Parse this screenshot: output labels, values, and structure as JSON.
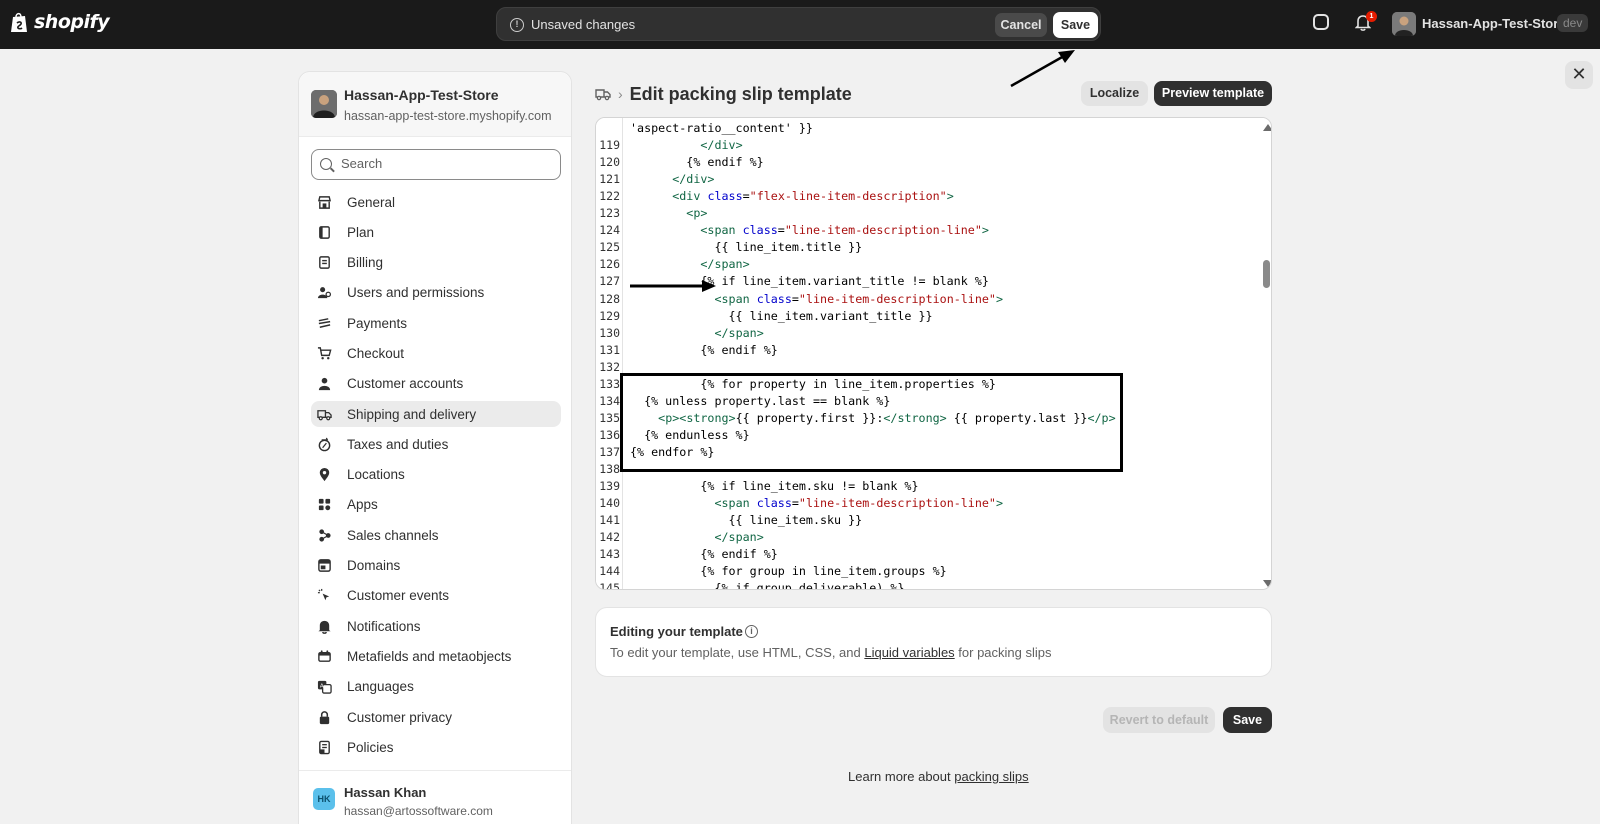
{
  "topbar": {
    "logo_text": "shopify",
    "unsaved_message": "Unsaved changes",
    "cancel_label": "Cancel",
    "save_label": "Save",
    "notification_count": "1",
    "store_name": "Hassan-App-Test-Store",
    "env_badge": "dev"
  },
  "sidebar": {
    "store_name": "Hassan-App-Test-Store",
    "store_url": "hassan-app-test-store.myshopify.com",
    "search_placeholder": "Search",
    "items": [
      {
        "label": "General",
        "icon": "store-icon"
      },
      {
        "label": "Plan",
        "icon": "plan-icon"
      },
      {
        "label": "Billing",
        "icon": "billing-icon"
      },
      {
        "label": "Users and permissions",
        "icon": "users-icon"
      },
      {
        "label": "Payments",
        "icon": "payments-icon"
      },
      {
        "label": "Checkout",
        "icon": "cart-icon"
      },
      {
        "label": "Customer accounts",
        "icon": "person-icon"
      },
      {
        "label": "Shipping and delivery",
        "icon": "truck-icon",
        "active": true
      },
      {
        "label": "Taxes and duties",
        "icon": "tax-icon"
      },
      {
        "label": "Locations",
        "icon": "location-icon"
      },
      {
        "label": "Apps",
        "icon": "apps-icon"
      },
      {
        "label": "Sales channels",
        "icon": "sales-channels-icon"
      },
      {
        "label": "Domains",
        "icon": "domains-icon"
      },
      {
        "label": "Customer events",
        "icon": "cursor-icon"
      },
      {
        "label": "Notifications",
        "icon": "bell-icon"
      },
      {
        "label": "Metafields and metaobjects",
        "icon": "metafields-icon"
      },
      {
        "label": "Languages",
        "icon": "languages-icon"
      },
      {
        "label": "Customer privacy",
        "icon": "lock-icon"
      },
      {
        "label": "Policies",
        "icon": "policies-icon"
      }
    ],
    "user": {
      "initials": "HK",
      "name": "Hassan Khan",
      "email": "hassan@artossoftware.com"
    }
  },
  "main": {
    "page_title": "Edit packing slip template",
    "localize_label": "Localize",
    "preview_label": "Preview template",
    "code_lines": [
      {
        "n": "",
        "text": "'aspect-ratio__content' }}"
      },
      {
        "n": "119",
        "text": "          </div>"
      },
      {
        "n": "120",
        "text": "        {% endif %}"
      },
      {
        "n": "121",
        "text": "      </div>"
      },
      {
        "n": "122",
        "text": "      <div class=\"flex-line-item-description\">"
      },
      {
        "n": "123",
        "text": "        <p>"
      },
      {
        "n": "124",
        "text": "          <span class=\"line-item-description-line\">"
      },
      {
        "n": "125",
        "text": "            {{ line_item.title }}"
      },
      {
        "n": "126",
        "text": "          </span>"
      },
      {
        "n": "127",
        "text": "          {% if line_item.variant_title != blank %}"
      },
      {
        "n": "128",
        "text": "            <span class=\"line-item-description-line\">"
      },
      {
        "n": "129",
        "text": "              {{ line_item.variant_title }}"
      },
      {
        "n": "130",
        "text": "            </span>"
      },
      {
        "n": "131",
        "text": "          {% endif %}"
      },
      {
        "n": "132",
        "text": ""
      },
      {
        "n": "133",
        "text": "          {% for property in line_item.properties %}"
      },
      {
        "n": "134",
        "text": "  {% unless property.last == blank %}"
      },
      {
        "n": "135",
        "text": "    <p><strong>{{ property.first }}:</strong> {{ property.last }}</p>"
      },
      {
        "n": "136",
        "text": "  {% endunless %}"
      },
      {
        "n": "137",
        "text": "{% endfor %}"
      },
      {
        "n": "138",
        "text": ""
      },
      {
        "n": "139",
        "text": "          {% if line_item.sku != blank %}"
      },
      {
        "n": "140",
        "text": "            <span class=\"line-item-description-line\">"
      },
      {
        "n": "141",
        "text": "              {{ line_item.sku }}"
      },
      {
        "n": "142",
        "text": "            </span>"
      },
      {
        "n": "143",
        "text": "          {% endif %}"
      },
      {
        "n": "144",
        "text": "          {% for group in line_item.groups %}"
      },
      {
        "n": "145",
        "text": "            {% if group.deliverable) %}"
      }
    ],
    "info": {
      "title": "Editing your template",
      "text_before": "To edit your template, use HTML, CSS, and ",
      "link": "Liquid variables",
      "text_after": " for packing slips"
    },
    "revert_label": "Revert to default",
    "save_label": "Save",
    "learn_text": "Learn more about ",
    "learn_link": "packing slips"
  }
}
